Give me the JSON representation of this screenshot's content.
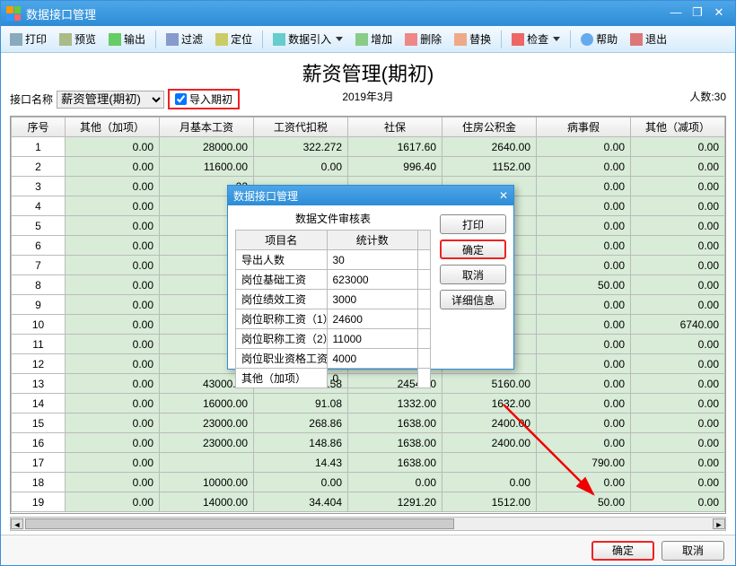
{
  "window": {
    "title": "数据接口管理"
  },
  "winctrl": {
    "min": "—",
    "max": "❐",
    "close": "✕"
  },
  "toolbar": {
    "print": "打印",
    "preview": "预览",
    "export": "输出",
    "filter": "过滤",
    "locate": "定位",
    "import": "数据引入",
    "add": "增加",
    "del": "删除",
    "replace": "替换",
    "check": "检查",
    "help": "帮助",
    "exit": "退出"
  },
  "header": {
    "title": "薪资管理(期初)",
    "label_interface": "接口名称",
    "select_value": "薪资管理(期初)",
    "checkbox_label": "导入期初",
    "date": "2019年3月",
    "count_label": "人数:30"
  },
  "cols": [
    "序号",
    "其他（加项）",
    "月基本工资",
    "工资代扣税",
    "社保",
    "住房公积金",
    "病事假",
    "其他（减项）"
  ],
  "rows": [
    [
      "1",
      "0.00",
      "28000.00",
      "322.272",
      "1617.60",
      "2640.00",
      "0.00",
      "0.00"
    ],
    [
      "2",
      "0.00",
      "11600.00",
      "0.00",
      "996.40",
      "1152.00",
      "0.00",
      "0.00"
    ],
    [
      "3",
      "0.00",
      "22",
      "",
      "",
      "",
      "0.00",
      "0.00"
    ],
    [
      "4",
      "0.00",
      "14",
      "",
      "",
      "",
      "0.00",
      "0.00"
    ],
    [
      "5",
      "0.00",
      "40",
      "",
      "",
      "",
      "0.00",
      "0.00"
    ],
    [
      "6",
      "0.00",
      "7",
      "",
      "",
      "",
      "0.00",
      "0.00"
    ],
    [
      "7",
      "0.00",
      "20",
      "",
      "",
      "",
      "0.00",
      "0.00"
    ],
    [
      "8",
      "0.00",
      "27",
      "",
      "",
      "",
      "50.00",
      "0.00"
    ],
    [
      "9",
      "0.00",
      "17",
      "",
      "",
      "",
      "0.00",
      "0.00"
    ],
    [
      "10",
      "0.00",
      "20",
      "",
      "",
      "",
      "0.00",
      "6740.00"
    ],
    [
      "11",
      "0.00",
      "16",
      "",
      "",
      "",
      "0.00",
      "0.00"
    ],
    [
      "12",
      "0.00",
      "",
      "",
      "",
      "",
      "0.00",
      "0.00"
    ],
    [
      "13",
      "0.00",
      "43000.00",
      "761.58",
      "2454.00",
      "5160.00",
      "0.00",
      "0.00"
    ],
    [
      "14",
      "0.00",
      "16000.00",
      "91.08",
      "1332.00",
      "1632.00",
      "0.00",
      "0.00"
    ],
    [
      "15",
      "0.00",
      "23000.00",
      "268.86",
      "1638.00",
      "2400.00",
      "0.00",
      "0.00"
    ],
    [
      "16",
      "0.00",
      "23000.00",
      "148.86",
      "1638.00",
      "2400.00",
      "0.00",
      "0.00"
    ],
    [
      "17",
      "0.00",
      "",
      "14.43",
      "1638.00",
      "",
      "790.00",
      "0.00"
    ],
    [
      "18",
      "0.00",
      "10000.00",
      "0.00",
      "0.00",
      "0.00",
      "0.00",
      "0.00"
    ],
    [
      "19",
      "0.00",
      "14000.00",
      "34.404",
      "1291.20",
      "1512.00",
      "50.00",
      "0.00"
    ]
  ],
  "footer": {
    "ok": "确定",
    "cancel": "取消"
  },
  "dialog": {
    "title": "数据接口管理",
    "subtitle": "数据文件审核表",
    "col1": "项目名",
    "col2": "统计数",
    "rows": [
      [
        "导出人数",
        "30"
      ],
      [
        "岗位基础工资",
        "623000"
      ],
      [
        "岗位绩效工资",
        "3000"
      ],
      [
        "岗位职称工资（1）",
        "24600"
      ],
      [
        "岗位职称工资（2）",
        "11000"
      ],
      [
        "岗位职业资格工资",
        "4000"
      ],
      [
        "其他（加项）",
        "0"
      ]
    ],
    "btn_print": "打印",
    "btn_ok": "确定",
    "btn_cancel": "取消",
    "btn_detail": "详细信息",
    "close": "✕"
  }
}
